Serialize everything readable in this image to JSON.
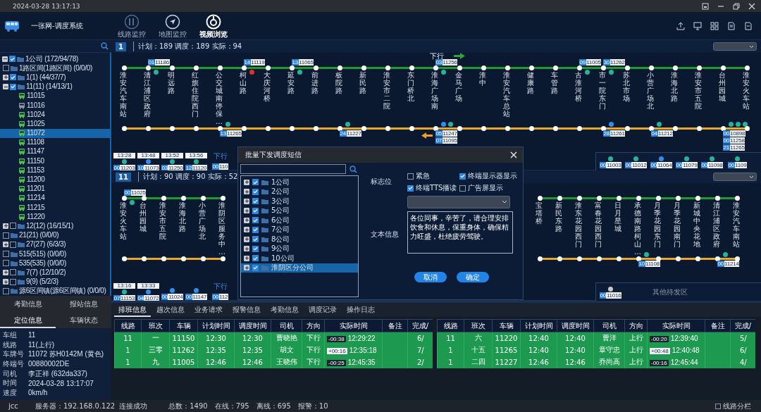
{
  "title_bar": {
    "datetime": "2024-03-28 13:17:13"
  },
  "header": {
    "app_title": "一张网-调度系统",
    "nav": [
      {
        "label": "线路监控",
        "selected": false
      },
      {
        "label": "地图监控",
        "selected": false
      },
      {
        "label": "视频浏览",
        "selected": true
      }
    ]
  },
  "sidebar": {
    "tree": [
      {
        "label": "1公司 (172/94/78)",
        "kind": "group",
        "expanded": true,
        "checked": true,
        "selected": false,
        "children": [
          {
            "label": "1路区间(1路区间) (0/0/0)",
            "kind": "group",
            "checked": false,
            "selected": false
          },
          {
            "label": "1(1) (44/37/7)",
            "kind": "group",
            "expanded": false,
            "checked": true,
            "selected": false
          },
          {
            "label": "11(11) (14/13/1)",
            "kind": "group",
            "expanded": true,
            "checked": true,
            "selected": false,
            "children": [
              {
                "label": "11015",
                "kind": "vehicle",
                "online": true,
                "selected": false
              },
              {
                "label": "11016",
                "kind": "vehicle",
                "online": false,
                "selected": false
              },
              {
                "label": "11024",
                "kind": "vehicle",
                "online": true,
                "selected": false
              },
              {
                "label": "11025",
                "kind": "vehicle",
                "online": true,
                "selected": false
              },
              {
                "label": "11072",
                "kind": "vehicle",
                "online": true,
                "selected": true
              },
              {
                "label": "11108",
                "kind": "vehicle",
                "online": true,
                "selected": false
              },
              {
                "label": "11147",
                "kind": "vehicle",
                "online": true,
                "selected": false
              },
              {
                "label": "11150",
                "kind": "vehicle",
                "online": true,
                "selected": false
              },
              {
                "label": "11153",
                "kind": "vehicle",
                "online": true,
                "selected": false
              },
              {
                "label": "11200",
                "kind": "vehicle",
                "online": true,
                "selected": false
              },
              {
                "label": "11201",
                "kind": "vehicle",
                "online": true,
                "selected": false
              },
              {
                "label": "11214",
                "kind": "vehicle",
                "online": true,
                "selected": false
              },
              {
                "label": "11215",
                "kind": "vehicle",
                "online": true,
                "selected": false
              },
              {
                "label": "11220",
                "kind": "vehicle",
                "online": true,
                "selected": false
              }
            ]
          },
          {
            "label": "12(12) (16/15/1)",
            "kind": "group",
            "expanded": false,
            "checked": false,
            "selected": false
          },
          {
            "label": "21(21) (0/0/0)",
            "kind": "group",
            "checked": false,
            "selected": false
          },
          {
            "label": "27(27) (6/3/3)",
            "kind": "group",
            "expanded": false,
            "checked": false,
            "selected": false
          },
          {
            "label": "515(515) (0/0/0)",
            "kind": "group",
            "checked": false,
            "selected": false
          },
          {
            "label": "535(535) (0/0/0)",
            "kind": "group",
            "checked": false,
            "selected": false
          },
          {
            "label": "7(7) (12/10/2)",
            "kind": "group",
            "expanded": false,
            "checked": false,
            "selected": false
          },
          {
            "label": "9(9) (5/2/3)",
            "kind": "group",
            "expanded": false,
            "checked": false,
            "selected": false
          },
          {
            "label": "源6区间镇(源6区间镇) (0/0/0)",
            "kind": "group",
            "checked": false,
            "selected": false
          }
        ]
      }
    ],
    "tabs": [
      {
        "label": "考勤信息",
        "selected": false
      },
      {
        "label": "报站信息",
        "selected": false
      },
      {
        "label": "定位信息",
        "selected": true
      },
      {
        "label": "车辆状态",
        "selected": false
      }
    ],
    "info": [
      {
        "label": "车组",
        "value": "11"
      },
      {
        "label": "线路",
        "value": "11(上行)"
      },
      {
        "label": "车牌号",
        "value": "11072  苏H0142M (黄色)"
      },
      {
        "label": "终端号",
        "value": "00880002DE"
      },
      {
        "label": "司机",
        "value": "李正祥 (632da337)"
      },
      {
        "label": "时间",
        "value": "2024-03-28 13:17:07"
      },
      {
        "label": "速度",
        "value": "0km/h"
      }
    ]
  },
  "route_panels": [
    {
      "number": "1",
      "stats": "计划：189  调度：189  实际：94",
      "segments": [
        {
          "stations": [
            {
              "name": "淮安汽车南站"
            },
            {
              "name": "清江浦区政府",
              "up": [
                {
                  "code": "01",
                  "number": "11186",
                  "color": "#27b39a"
                }
              ]
            },
            {
              "name": "明远路"
            },
            {
              "name": "红旗住院西门"
            },
            {
              "name": "公交城南停保…",
              "down": [
                {
                  "code": "13",
                  "number": "11265",
                  "color": "#27b39a"
                }
              ]
            },
            {
              "name": "柯山路",
              "up": [
                {
                  "code": "14",
                  "number": "11119",
                  "color": "#e0302a"
                }
              ]
            },
            {
              "name": "大庆河桥"
            },
            {
              "name": "延安路",
              "up": [
                {
                  "code": "13",
                  "number": "11065",
                  "color": "#27b39a"
                }
              ]
            },
            {
              "name": "前进路"
            },
            {
              "name": "板院路",
              "down": [
                {
                  "code": "24",
                  "number": "11227",
                  "color": "#27b39a"
                }
              ]
            },
            {
              "name": "新民路"
            },
            {
              "name": "淮安市二院"
            },
            {
              "name": "东门桥北"
            },
            {
              "name": "淮海广场南",
              "direction_label": "下行",
              "up": [
                {
                  "code": "03",
                  "number": "11256",
                  "color": "#27b39a"
                }
              ],
              "down": [
                {
                  "code": "05",
                  "number": "11247",
                  "color": "#2d8ff0"
                },
                {
                  "code": "07",
                  "number": "11095",
                  "color": "#27b39a"
                }
              ]
            },
            {
              "name": "金马广场"
            },
            {
              "name": "淮中"
            },
            {
              "name": "淮安汽车总站"
            },
            {
              "name": "健康路"
            },
            {
              "name": "车管路"
            },
            {
              "name": "古淮河桥",
              "up": [
                {
                  "code": "09",
                  "number": "11005",
                  "color": "#27b39a"
                }
              ]
            },
            {
              "name": "市一院东门",
              "up": [
                {
                  "code": "30",
                  "number": "11262",
                  "color": "#27b39a"
                }
              ],
              "down": [
                {
                  "code": "28",
                  "number": "11261",
                  "color": "#2d8ff0"
                }
              ]
            },
            {
              "name": "苏北市场"
            },
            {
              "name": "小营广场北",
              "down": [
                {
                  "code": "04",
                  "number": "11212",
                  "color": "#27b39a"
                }
              ]
            },
            {
              "name": "淮海北路"
            },
            {
              "name": "淮安市五院"
            },
            {
              "name": "台州园城",
              "down": [
                {
                  "code": "00",
                  "number": "10898",
                  "color": "#27b39a"
                },
                {
                  "code": "00",
                  "number": "11258",
                  "color": "#27b39a"
                },
                {
                  "code": "21",
                  "number": "11265",
                  "color": "#27b39a"
                }
              ]
            },
            {
              "name": "淮安火车站"
            }
          ]
        }
      ],
      "depot": {
        "slots": [
          {
            "time": "13:28",
            "code": "00",
            "number": "11203",
            "color": "#27b39a"
          },
          {
            "time": "13:48",
            "code": "10",
            "number": "11073",
            "color": "#2d8ff0"
          },
          {
            "time": "13:52",
            "code": "03",
            "number": "11250",
            "color": "#27b39a"
          },
          {
            "time": "13:56",
            "code": "12",
            "number": "11120",
            "color": "#27b39a"
          },
          {
            "label": "下行",
            "code": "00",
            "number": "110"
          }
        ],
        "waiting": [
          {
            "code": "00",
            "number": "11003",
            "color": "#27b39a"
          },
          {
            "code": "00",
            "number": "11012",
            "color": "#27b39a"
          },
          {
            "code": "00",
            "number": "11064",
            "color": "#2d8ff0"
          },
          {
            "code": "00",
            "number": "11079",
            "color": "#27b39a"
          },
          {
            "code": "00",
            "number": "11098",
            "color": "#27b39a"
          },
          {
            "code": "00",
            "number": "1109",
            "color": "#27b39a"
          }
        ]
      }
    },
    {
      "number": "11",
      "stats": "计划：90  调度：90  实际：52",
      "segments": [
        {
          "stations": [
            {
              "name": "淮安火车站",
              "up": [
                {
                  "code": "00",
                  "number": "11025",
                  "color": "#27b39a"
                }
              ]
            },
            {
              "name": "台州园城"
            },
            {
              "name": "淮安市五院"
            },
            {
              "name": "淮海北路"
            },
            {
              "name": "小营广场北"
            },
            {
              "name": "淮阴区服务中…"
            }
          ]
        },
        {
          "stations": [
            {
              "name": "宝塔桥"
            },
            {
              "name": "新民东路"
            },
            {
              "name": "淮东花园西门"
            },
            {
              "name": "富春花园西门"
            },
            {
              "name": "日月星城"
            },
            {
              "name": "承德南路柯山…",
              "down": [
                {
                  "code": "10",
                  "number": "11108",
                  "color": "#27b39a"
                }
              ]
            },
            {
              "name": "月季花园东门"
            },
            {
              "name": "月季花园南门"
            },
            {
              "name": "新城中央花地"
            },
            {
              "name": "清江浦区政府",
              "down": [
                {
                  "code": "00",
                  "number": "11214",
                  "color": "#27b39a"
                }
              ]
            },
            {
              "name": "淮安汽车南站"
            }
          ]
        }
      ],
      "depot": {
        "slots": [
          {
            "time": "13:16",
            "code": "07",
            "number": "11153",
            "color": "#27b39a"
          },
          {
            "time": "13:33",
            "code": "04",
            "number": "11072",
            "color": "#2d8ff0"
          },
          {
            "code": "00",
            "number": "11024",
            "color": "#2d8ff0"
          },
          {
            "code": "00",
            "number": "11147",
            "color": "#2d8ff0"
          },
          {
            "label": "下行",
            "code": "00",
            "number": "112"
          }
        ],
        "waiting": [
          {
            "code": "00",
            "number": "11016",
            "color": "#c8c8c8"
          }
        ],
        "area_label": "其他待发区"
      }
    }
  ],
  "dialog": {
    "title": "批量下发调度短信",
    "companies": [
      {
        "label": "1公司",
        "expanded": false,
        "checked": true,
        "selected": false
      },
      {
        "label": "2公司",
        "expanded": false,
        "checked": true,
        "selected": false
      },
      {
        "label": "3公司",
        "expanded": false,
        "checked": true,
        "selected": false
      },
      {
        "label": "5公司",
        "expanded": false,
        "checked": true,
        "selected": false
      },
      {
        "label": "6公司",
        "expanded": false,
        "checked": true,
        "selected": false
      },
      {
        "label": "7公司",
        "expanded": false,
        "checked": true,
        "selected": false
      },
      {
        "label": "8公司",
        "expanded": false,
        "checked": true,
        "selected": false
      },
      {
        "label": "9公司",
        "expanded": false,
        "checked": true,
        "selected": false
      },
      {
        "label": "10公司",
        "expanded": false,
        "checked": true,
        "selected": false
      },
      {
        "label": "淮阴区分公司",
        "expanded": false,
        "checked": true,
        "selected": true
      }
    ],
    "flags_label": "标志位",
    "flags": [
      {
        "label": "紧急",
        "checked": false
      },
      {
        "label": "终端显示器显示",
        "checked": true
      },
      {
        "label": "终端TTS播读",
        "checked": true
      },
      {
        "label": "广告屏显示",
        "checked": false
      }
    ],
    "text_label": "文本信息",
    "message": "各位同事，辛苦了，请合理安排饮食和休息，保重身体，确保精力旺盛，杜绝疲劳驾驶。",
    "buttons": [
      "取消",
      "确定"
    ]
  },
  "bottom_tabs": [
    {
      "label": "排班信息",
      "selected": true
    },
    {
      "label": "趟次信息",
      "selected": false
    },
    {
      "label": "业务请求",
      "selected": false
    },
    {
      "label": "报警信息",
      "selected": false
    },
    {
      "label": "考勤信息",
      "selected": false
    },
    {
      "label": "调度记录",
      "selected": false
    },
    {
      "label": "操作日志",
      "selected": false
    }
  ],
  "tables": [
    {
      "columns": [
        "线路",
        "班次",
        "车辆",
        "计划时间",
        "调度时间",
        "司机",
        "方向",
        "实际时间",
        "备注",
        "完成/"
      ],
      "rows": [
        {
          "cells": [
            "11",
            "一",
            "11150",
            "12:30",
            "12:30",
            "曹晓艳",
            "下行",
            {
              "deviation": "-00:38",
              "time": "12:29:22",
              "late": false
            },
            "",
            "6/"
          ]
        },
        {
          "cells": [
            "1",
            "三零",
            "11262",
            "12:35",
            "12:35",
            "胡文",
            "下行",
            {
              "deviation": "+00:16",
              "time": "12:35:18",
              "late": true
            },
            "",
            "7/"
          ]
        },
        {
          "cells": [
            "1",
            "九",
            "11005",
            "12:46",
            "12:46",
            "王晓伟",
            "下行",
            {
              "deviation": "-00:25",
              "time": "12:45:35",
              "late": false
            },
            "",
            "2/"
          ]
        }
      ]
    },
    {
      "columns": [
        "线路",
        "班次",
        "车辆",
        "计划时间",
        "调度时间",
        "司机",
        "方向",
        "实际时间",
        "备注",
        "完成/"
      ],
      "rows": [
        {
          "cells": [
            "11",
            "六",
            "11220",
            "12:40",
            "12:40",
            "曹洋",
            "上行",
            {
              "deviation": "-00:20",
              "time": "12:39:40",
              "late": false
            },
            "",
            "5/"
          ]
        },
        {
          "cells": [
            "1",
            "十五",
            "11265",
            "12:40",
            "12:40",
            "章守忠",
            "上行",
            {
              "deviation": "+00:48",
              "time": "12:40:48",
              "late": true
            },
            "",
            "6/"
          ]
        },
        {
          "cells": [
            "1",
            "二四",
            "11227",
            "12:46",
            "12:46",
            "乔尚高",
            "上行",
            {
              "deviation": "-00:16",
              "time": "12:45:44",
              "late": false
            },
            "",
            "4/"
          ]
        }
      ]
    }
  ],
  "status_bar": {
    "user": "jcc",
    "server": "服务器：192.168.0.122",
    "connection": "连接成功",
    "counts": [
      "总数：1490",
      "在线：795",
      "离线：695",
      "报警：10"
    ],
    "split_option": {
      "label": "线路分栏",
      "checked": false
    }
  }
}
